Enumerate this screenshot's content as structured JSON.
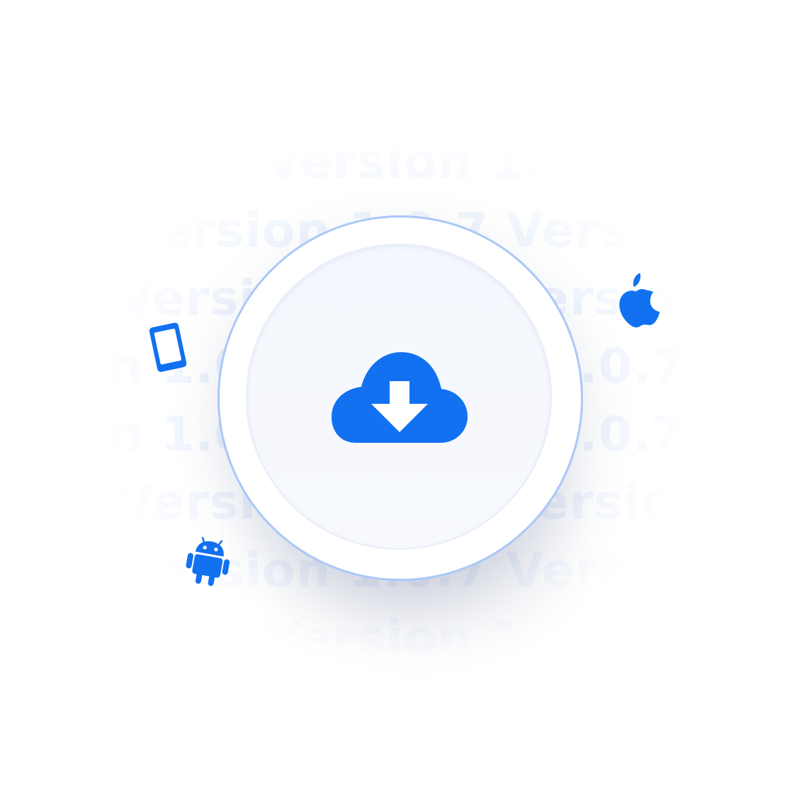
{
  "watermark": {
    "text": "Version 1.0.7 Version 1.0.7 Version 1.0.7"
  },
  "icons": {
    "main": "cloud-download-icon",
    "left": "tablet-icon",
    "right": "apple-icon",
    "bottom_left": "android-icon"
  },
  "colors": {
    "accent": "#1271f0",
    "ring": "#a9c8f7",
    "watermark": "#dbe6fb"
  }
}
